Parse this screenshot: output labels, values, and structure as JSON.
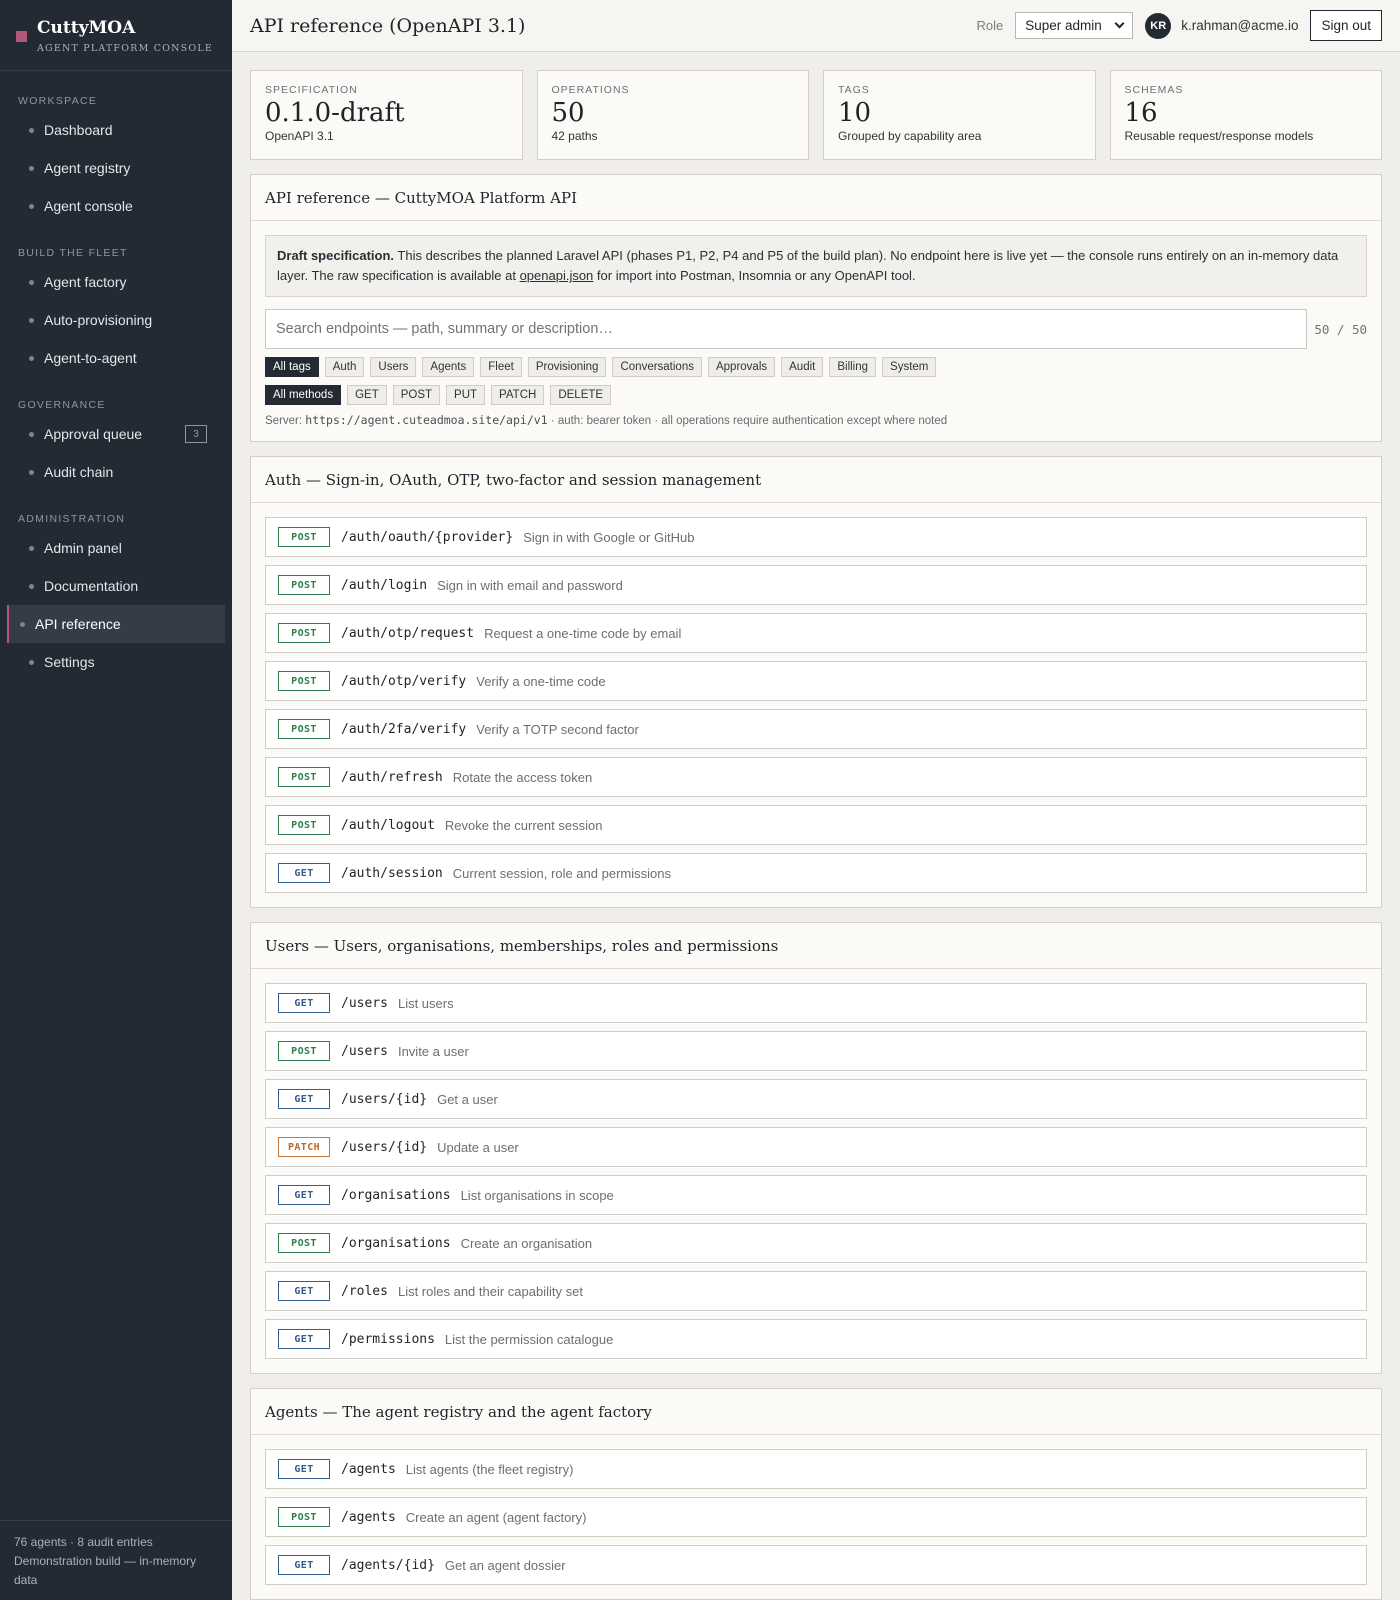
{
  "brand": {
    "name": "CuttyMOA",
    "subtitle": "AGENT PLATFORM CONSOLE"
  },
  "sidebar": {
    "sections": [
      {
        "title": "WORKSPACE",
        "items": [
          {
            "label": "Dashboard"
          },
          {
            "label": "Agent registry"
          },
          {
            "label": "Agent console"
          }
        ]
      },
      {
        "title": "BUILD THE FLEET",
        "items": [
          {
            "label": "Agent factory"
          },
          {
            "label": "Auto-provisioning"
          },
          {
            "label": "Agent-to-agent"
          }
        ]
      },
      {
        "title": "GOVERNANCE",
        "items": [
          {
            "label": "Approval queue",
            "badge": "3"
          },
          {
            "label": "Audit chain"
          }
        ]
      },
      {
        "title": "ADMINISTRATION",
        "items": [
          {
            "label": "Admin panel"
          },
          {
            "label": "Documentation"
          },
          {
            "label": "API reference",
            "active": true
          },
          {
            "label": "Settings"
          }
        ]
      }
    ],
    "footer": {
      "line1": "76 agents · 8 audit entries",
      "line2": "Demonstration build — in-memory data"
    }
  },
  "header": {
    "title": "API reference (OpenAPI 3.1)",
    "role_label": "Role",
    "role_value": "Super admin",
    "avatar_initials": "KR",
    "user_email": "k.rahman@acme.io",
    "signout_label": "Sign out"
  },
  "stats": [
    {
      "label": "SPECIFICATION",
      "value": "0.1.0-draft",
      "sub": "OpenAPI 3.1"
    },
    {
      "label": "OPERATIONS",
      "value": "50",
      "sub": "42 paths"
    },
    {
      "label": "TAGS",
      "value": "10",
      "sub": "Grouped by capability area"
    },
    {
      "label": "SCHEMAS",
      "value": "16",
      "sub": "Reusable request/response models"
    }
  ],
  "overview": {
    "title": "API reference — CuttyMOA Platform API",
    "draft_bold": "Draft specification.",
    "draft_text1": " This describes the planned Laravel API (phases P1, P2, P4 and P5 of the build plan). No endpoint here is live yet — the console runs entirely on an in-memory data layer. The raw specification is available at ",
    "draft_link": "openapi.json",
    "draft_text2": " for import into Postman, Insomnia or any OpenAPI tool.",
    "search_placeholder": "Search endpoints — path, summary or description…",
    "count": "50 / 50",
    "tags": [
      "All tags",
      "Auth",
      "Users",
      "Agents",
      "Fleet",
      "Provisioning",
      "Conversations",
      "Approvals",
      "Audit",
      "Billing",
      "System"
    ],
    "methods": [
      "All methods",
      "GET",
      "POST",
      "PUT",
      "PATCH",
      "DELETE"
    ],
    "server_label": "Server: ",
    "server_url": "https://agent.cuteadmoa.site/api/v1",
    "server_note": " · auth: bearer token · all operations require authentication except where noted"
  },
  "groups": [
    {
      "title": "Auth — Sign-in, OAuth, OTP, two-factor and session management",
      "endpoints": [
        {
          "method": "POST",
          "path": "/auth/oauth/{provider}",
          "summary": "Sign in with Google or GitHub"
        },
        {
          "method": "POST",
          "path": "/auth/login",
          "summary": "Sign in with email and password"
        },
        {
          "method": "POST",
          "path": "/auth/otp/request",
          "summary": "Request a one-time code by email"
        },
        {
          "method": "POST",
          "path": "/auth/otp/verify",
          "summary": "Verify a one-time code"
        },
        {
          "method": "POST",
          "path": "/auth/2fa/verify",
          "summary": "Verify a TOTP second factor"
        },
        {
          "method": "POST",
          "path": "/auth/refresh",
          "summary": "Rotate the access token"
        },
        {
          "method": "POST",
          "path": "/auth/logout",
          "summary": "Revoke the current session"
        },
        {
          "method": "GET",
          "path": "/auth/session",
          "summary": "Current session, role and permissions"
        }
      ]
    },
    {
      "title": "Users — Users, organisations, memberships, roles and permissions",
      "endpoints": [
        {
          "method": "GET",
          "path": "/users",
          "summary": "List users"
        },
        {
          "method": "POST",
          "path": "/users",
          "summary": "Invite a user"
        },
        {
          "method": "GET",
          "path": "/users/{id}",
          "summary": "Get a user"
        },
        {
          "method": "PATCH",
          "path": "/users/{id}",
          "summary": "Update a user"
        },
        {
          "method": "GET",
          "path": "/organisations",
          "summary": "List organisations in scope"
        },
        {
          "method": "POST",
          "path": "/organisations",
          "summary": "Create an organisation"
        },
        {
          "method": "GET",
          "path": "/roles",
          "summary": "List roles and their capability set"
        },
        {
          "method": "GET",
          "path": "/permissions",
          "summary": "List the permission catalogue"
        }
      ]
    },
    {
      "title": "Agents — The agent registry and the agent factory",
      "endpoints": [
        {
          "method": "GET",
          "path": "/agents",
          "summary": "List agents (the fleet registry)"
        },
        {
          "method": "POST",
          "path": "/agents",
          "summary": "Create an agent (agent factory)"
        },
        {
          "method": "GET",
          "path": "/agents/{id}",
          "summary": "Get an agent dossier"
        }
      ]
    }
  ]
}
